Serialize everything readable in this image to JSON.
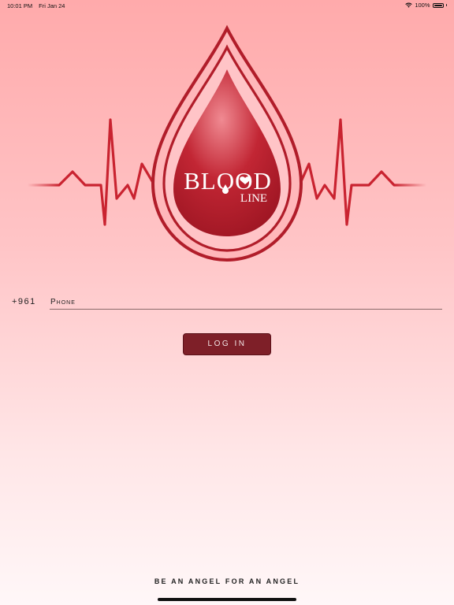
{
  "status_bar": {
    "time": "10:01 PM",
    "date": "Fri Jan 24",
    "battery": "100%",
    "icons": [
      "wifi-icon",
      "battery-icon"
    ]
  },
  "logo": {
    "word_main": "BLOOD",
    "word_sub": "LINE",
    "colors": {
      "drop": "#b8202c",
      "drop_dark": "#8c1220",
      "pulse": "#c92330"
    }
  },
  "login_form": {
    "country_code": "+961",
    "phone_placeholder": "Phone",
    "phone_value": "",
    "login_label": "LOG IN"
  },
  "footer": {
    "tagline": "BE AN ANGEL FOR AN ANGEL"
  },
  "colors": {
    "background_top": "#ffaaab",
    "background_bottom": "#fff7f8",
    "button": "#7e1f28"
  }
}
